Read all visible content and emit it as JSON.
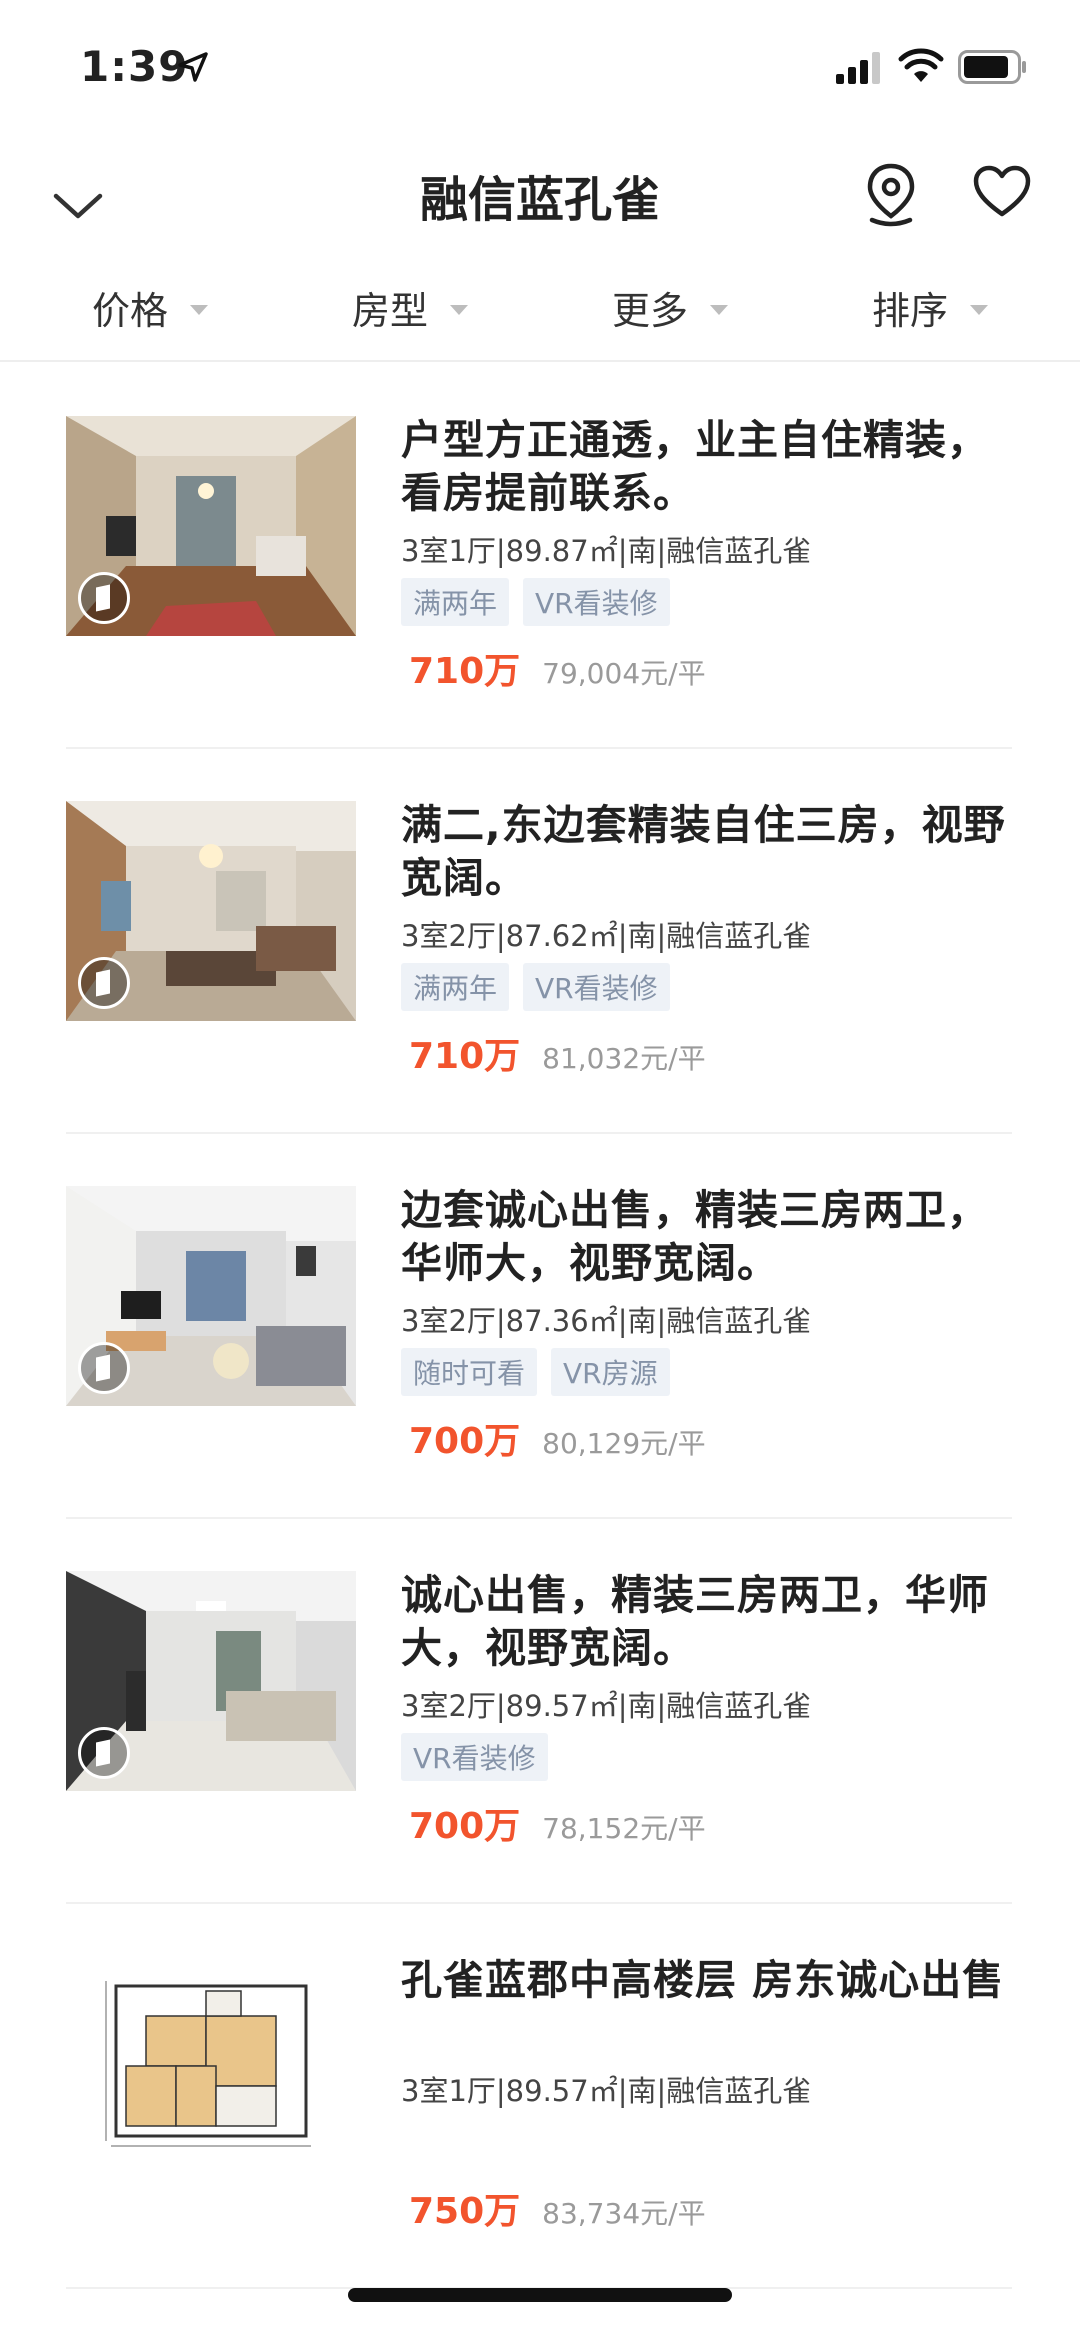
{
  "status": {
    "time": "1:39"
  },
  "nav": {
    "title": "融信蓝孔雀"
  },
  "filters": [
    {
      "label": "价格"
    },
    {
      "label": "房型"
    },
    {
      "label": "更多"
    },
    {
      "label": "排序"
    }
  ],
  "listings": [
    {
      "title": "户型方正通透，业主自住精装，看房提前联系。",
      "meta": "3室1厅|89.87㎡|南|融信蓝孔雀",
      "tags": [
        "满两年",
        "VR看装修"
      ],
      "price": "710万",
      "unit_price": "79,004元/平",
      "image": "living-room-photo",
      "vr": true
    },
    {
      "title": "满二,东边套精装自住三房，视野宽阔。",
      "meta": "3室2厅|87.62㎡|南|融信蓝孔雀",
      "tags": [
        "满两年",
        "VR看装修"
      ],
      "price": "710万",
      "unit_price": "81,032元/平",
      "image": "living-room-photo",
      "vr": true
    },
    {
      "title": "边套诚心出售，精装三房两卫，华师大，视野宽阔。",
      "meta": "3室2厅|87.36㎡|南|融信蓝孔雀",
      "tags": [
        "随时可看",
        "VR房源"
      ],
      "price": "700万",
      "unit_price": "80,129元/平",
      "image": "living-room-photo",
      "vr": true
    },
    {
      "title": "诚心出售，精装三房两卫，华师大，视野宽阔。",
      "meta": "3室2厅|89.57㎡|南|融信蓝孔雀",
      "tags": [
        "VR看装修"
      ],
      "price": "700万",
      "unit_price": "78,152元/平",
      "image": "living-room-photo",
      "vr": true
    },
    {
      "title": "孔雀蓝郡中高楼层 房东诚心出售",
      "meta": "3室1厅|89.57㎡|南|融信蓝孔雀",
      "tags": [],
      "price": "750万",
      "unit_price": "83,734元/平",
      "image": "floor-plan",
      "vr": false
    }
  ],
  "colors": {
    "price": "#f2542d",
    "tag_bg": "#eef2f7",
    "tag_text": "#8593a8"
  }
}
